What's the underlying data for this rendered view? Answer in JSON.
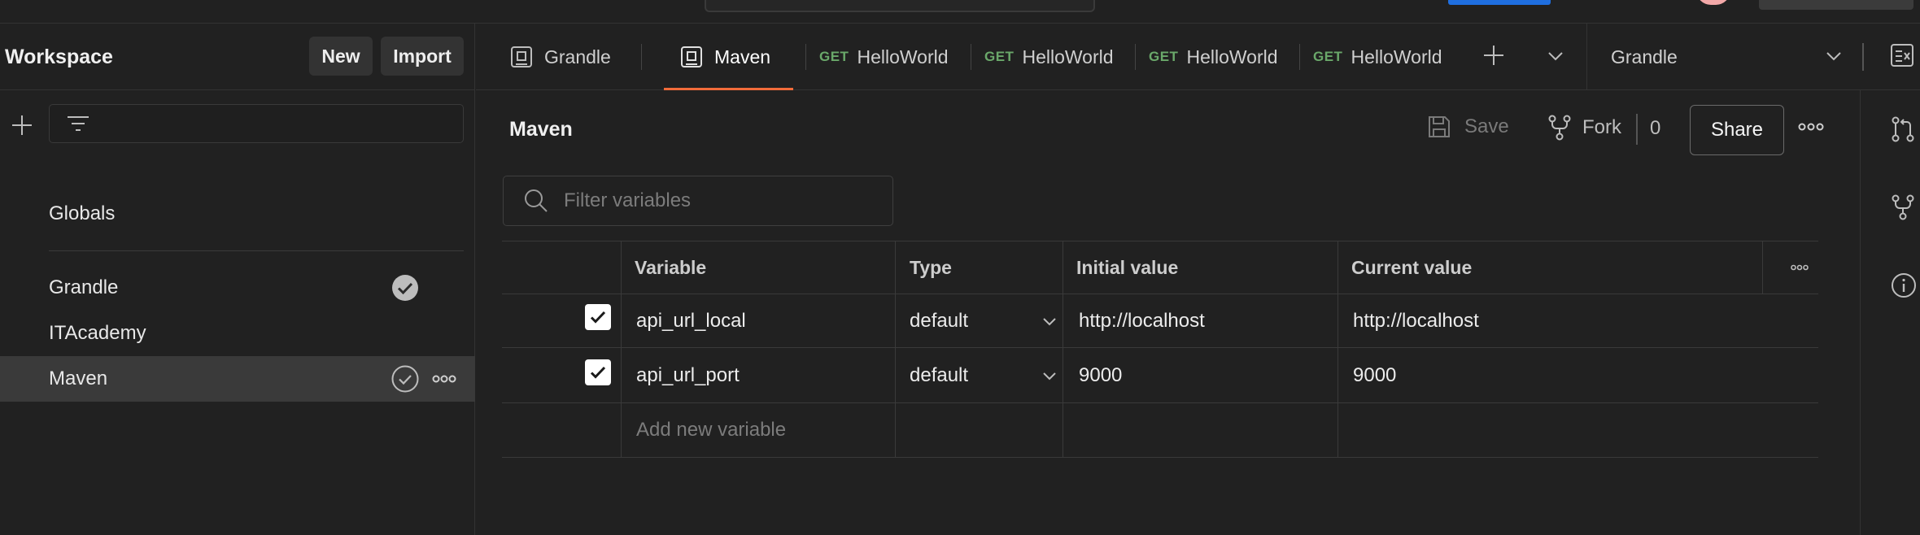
{
  "sidebar": {
    "title": "Workspace",
    "new_label": "New",
    "import_label": "Import",
    "filter_placeholder": "",
    "items": [
      {
        "label": "Globals"
      },
      {
        "label": "Grandle",
        "active_env": true
      },
      {
        "label": "ITAcademy"
      },
      {
        "label": "Maven",
        "selected": true
      }
    ]
  },
  "tabs": [
    {
      "label": "Grandle",
      "method": "",
      "icon": "environment-icon"
    },
    {
      "label": "Maven",
      "method": "",
      "icon": "environment-icon",
      "active": true
    },
    {
      "label": "HelloWorld",
      "method": "GET"
    },
    {
      "label": "HelloWorld",
      "method": "GET"
    },
    {
      "label": "HelloWorld",
      "method": "GET"
    },
    {
      "label": "HelloWorld",
      "method": "GET"
    }
  ],
  "environment_selector": {
    "selected": "Grandle"
  },
  "main": {
    "title": "Maven",
    "save_label": "Save",
    "fork_label": "Fork",
    "fork_count": "0",
    "share_label": "Share",
    "filter_placeholder": "Filter variables"
  },
  "table": {
    "headers": {
      "variable": "Variable",
      "type": "Type",
      "initial": "Initial value",
      "current": "Current value"
    },
    "rows": [
      {
        "checked": true,
        "variable": "api_url_local",
        "type": "default",
        "initial": "http://localhost",
        "current": "http://localhost"
      },
      {
        "checked": true,
        "variable": "api_url_port",
        "type": "default",
        "initial": "9000",
        "current": "9000"
      }
    ],
    "add_placeholder": "Add new variable"
  },
  "colors": {
    "background": "#212121",
    "accent_tab_underline": "#f26b3a",
    "get_method": "#6aa86a",
    "selected_row": "#3a3a3a"
  }
}
